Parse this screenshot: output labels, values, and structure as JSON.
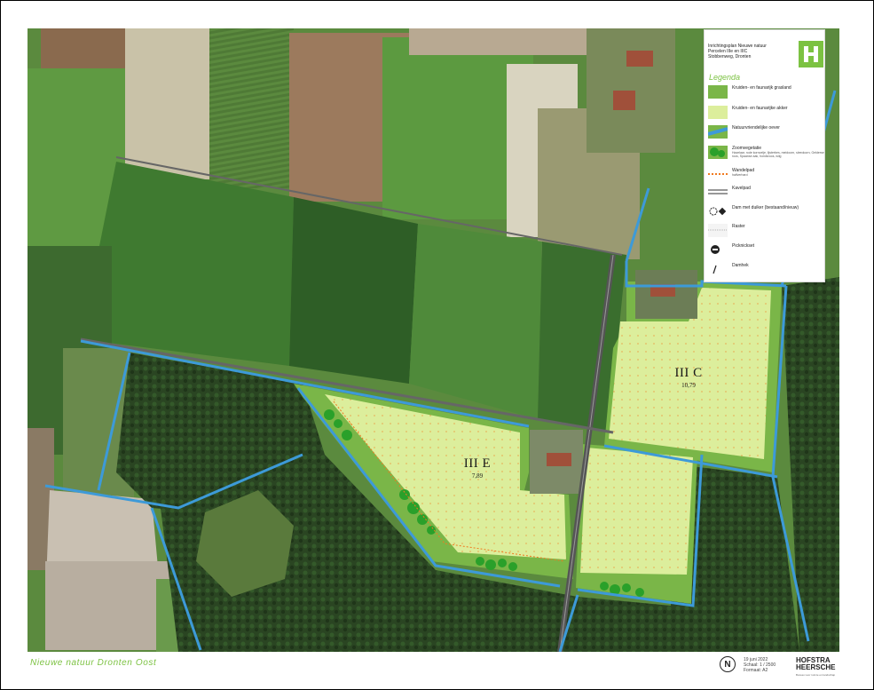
{
  "legend": {
    "title_lines": [
      "Inrichtingsplan Nieuwe natuur",
      "Percelen IIIe en IIIC",
      "Stobbenweg, Dronten"
    ],
    "logo": "H",
    "heading": "Legenda",
    "items": [
      {
        "label": "Kruiden- en faunarijk grasland",
        "sub": "",
        "swatch": "grassland",
        "color": "#7ab648"
      },
      {
        "label": "Kruiden- en faunarijke akker",
        "sub": "",
        "swatch": "akker",
        "color": "#dcee9c"
      },
      {
        "label": "Natuurvriendelijke oever",
        "sub": "",
        "swatch": "oever",
        "color": "#3d9ad8"
      },
      {
        "label": "Zoomvegetatie",
        "sub": "Hazelaar, rode kornoelje, lijsterbes, meidoorn, sleedoorn, Gelderse roos, Spaanse aak, hondsroos, wilg",
        "swatch": "zoom",
        "color": "#2aa02a"
      },
      {
        "label": "Wandelpad",
        "sub": "halfverhard",
        "swatch": "path",
        "color": "#f07a20"
      },
      {
        "label": "Kavelpad",
        "sub": "",
        "swatch": "kavelpad",
        "color": "#777777"
      },
      {
        "label": "Dam met duiker (bestaand/nieuw)",
        "sub": "",
        "swatch": "dam",
        "color": "#222222"
      },
      {
        "label": "Raster",
        "sub": "",
        "swatch": "raster",
        "color": "#999999"
      },
      {
        "label": "Picknickset",
        "sub": "",
        "swatch": "picnic",
        "color": "#222222"
      },
      {
        "label": "Damhek",
        "sub": "",
        "swatch": "gate",
        "color": "#222222"
      }
    ]
  },
  "parcels": [
    {
      "name": "III C",
      "area": "10,79"
    },
    {
      "name": "III E",
      "area": "7,89"
    }
  ],
  "footer": {
    "title": "Nieuwe natuur Dronten Oost",
    "north": "N",
    "meta_lines": [
      "19 juni 2022",
      "Schaal: 1 / 2500",
      "Formaat: A2"
    ],
    "brand_lines": [
      "HOFSTRA",
      "HEERSCHE"
    ],
    "brand_sub": "Bureau voor ruimte en landschap"
  },
  "colors": {
    "grassland": "#7ab648",
    "akker": "#dcee9c",
    "water": "#3d9ad8",
    "path": "#f07a20",
    "forest": "#26401f"
  }
}
